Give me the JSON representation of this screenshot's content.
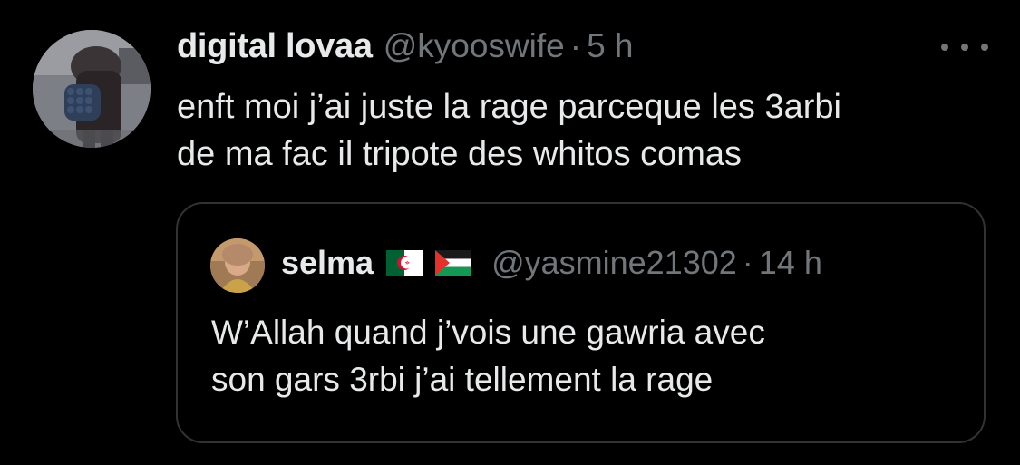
{
  "tweet": {
    "display_name": "digital lovaa",
    "handle": "@kyooswife",
    "separator": "·",
    "timestamp": "5 h",
    "text_lines": [
      "enft moi j’ai juste la rage parceque les 3arbi",
      "de ma fac il tripote des whitos comas"
    ],
    "more_icon": "more-horizontal-icon"
  },
  "quoted_tweet": {
    "display_name": "selma",
    "flags": [
      "algeria-flag-icon",
      "palestine-flag-icon"
    ],
    "handle": "@yasmine21302",
    "separator": "·",
    "timestamp": "14 h",
    "text_lines": [
      "W’Allah quand j’vois une gawria avec",
      "son gars 3rbi j’ai tellement la rage"
    ]
  },
  "colors": {
    "background": "#000000",
    "primary_text": "#e7e9ea",
    "secondary_text": "#71767b",
    "border": "#2f3336"
  }
}
